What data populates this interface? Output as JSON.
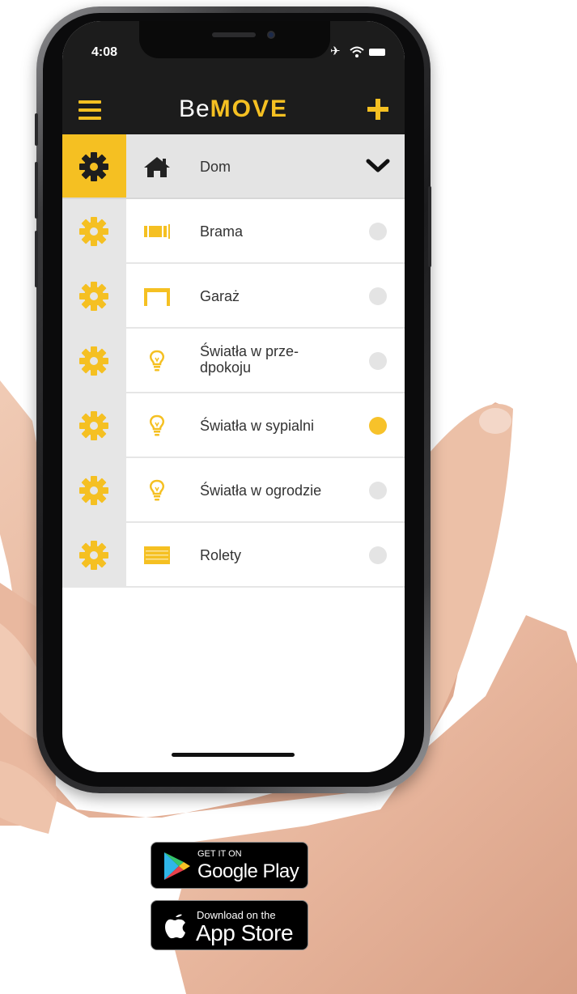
{
  "status_bar": {
    "time": "4:08"
  },
  "header": {
    "title_prefix": "Be",
    "title_suffix": "MOVE"
  },
  "group": {
    "label": "Dom",
    "icon": "home-icon"
  },
  "devices": [
    {
      "label": "Brama",
      "icon": "gate-icon",
      "state": "off"
    },
    {
      "label": "Garaż",
      "icon": "garage-icon",
      "state": "off"
    },
    {
      "label": "Światła w prze-\ndpokoju",
      "icon": "bulb-icon",
      "state": "off"
    },
    {
      "label": "Światła w sypialni",
      "icon": "bulb-icon",
      "state": "on"
    },
    {
      "label": "Światła w ogrodzie",
      "icon": "bulb-icon",
      "state": "off"
    },
    {
      "label": "Rolety",
      "icon": "blinds-icon",
      "state": "off"
    }
  ],
  "badges": {
    "google_play": {
      "small": "GET IT ON",
      "big": "Google Play"
    },
    "app_store": {
      "small": "Download on the",
      "big": "App Store"
    }
  },
  "colors": {
    "accent": "#f5c022",
    "header_bg": "#1c1c1c",
    "row_bg": "#ffffff",
    "gear_bg": "#e6e6e6",
    "toggle_off": "#e4e4e4"
  }
}
